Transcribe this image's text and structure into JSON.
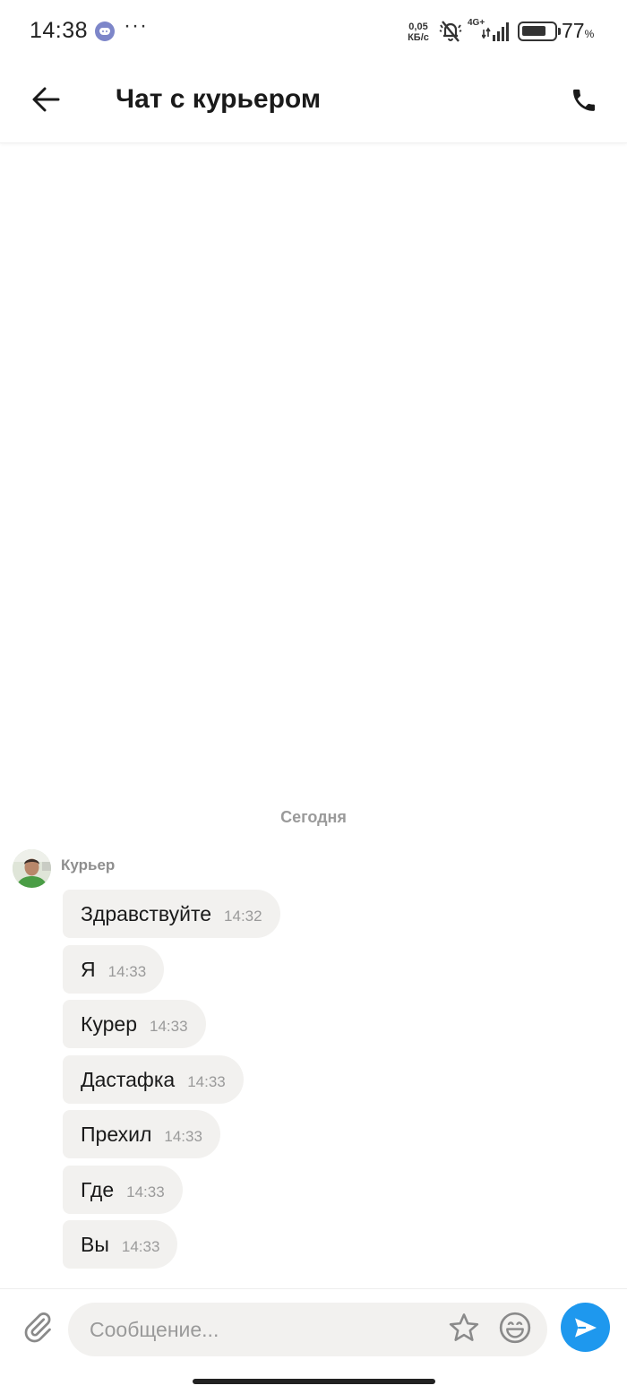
{
  "status_bar": {
    "time": "14:38",
    "more_dots": "···",
    "net_speed_value": "0,05",
    "net_speed_unit": "КБ/с",
    "network_type": "4G+",
    "battery_level": 0.77,
    "battery_percent": "77",
    "percent_sign": "%",
    "icons": [
      "discord-icon",
      "more-icon",
      "mute-icon",
      "signal-icon",
      "battery-icon"
    ]
  },
  "header": {
    "title": "Чат с курьером",
    "icons": [
      "back-arrow-icon",
      "phone-icon"
    ]
  },
  "chat": {
    "date_separator": "Сегодня",
    "sender_name": "Курьер",
    "messages": [
      {
        "text": "Здравствуйте",
        "time": "14:32"
      },
      {
        "text": "Я",
        "time": "14:33"
      },
      {
        "text": "Курер",
        "time": "14:33"
      },
      {
        "text": "Дастафка",
        "time": "14:33"
      },
      {
        "text": "Прехил",
        "time": "14:33"
      },
      {
        "text": "Где",
        "time": "14:33"
      },
      {
        "text": "Вы",
        "time": "14:33"
      }
    ]
  },
  "composer": {
    "placeholder": "Сообщение...",
    "value": "",
    "icons": [
      "paperclip-icon",
      "star-icon",
      "emoji-icon",
      "send-icon"
    ]
  },
  "colors": {
    "accent": "#1e98ee",
    "bubble_bg": "#f2f1ef",
    "muted_text": "#9a9a9a"
  }
}
